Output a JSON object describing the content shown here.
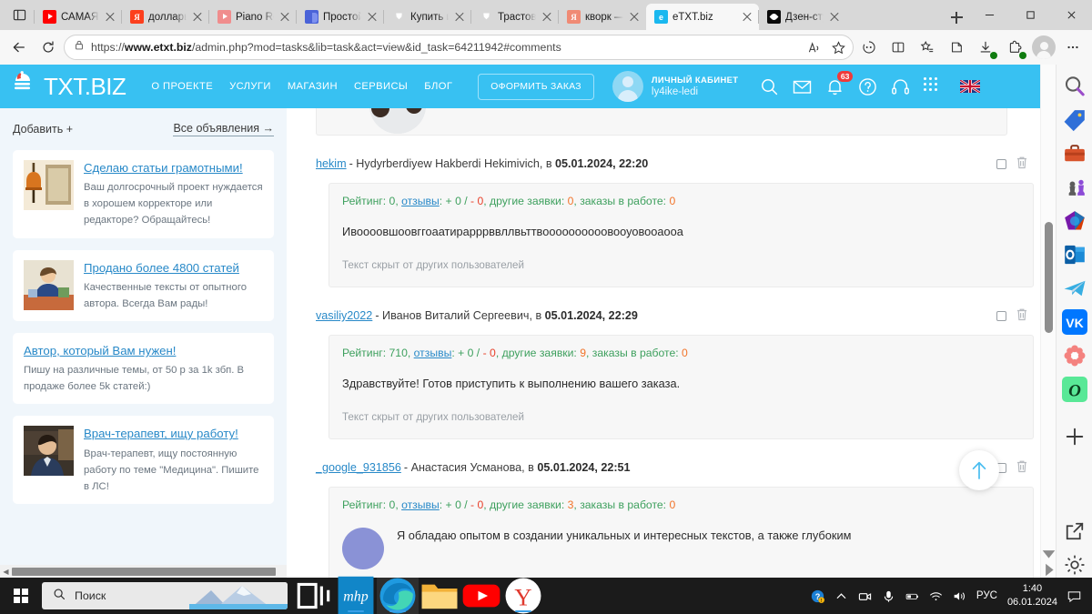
{
  "browser": {
    "tabs": [
      {
        "label": "САМАЯ С",
        "icon": "youtube-icon",
        "favclass": "fav-yt",
        "active": false
      },
      {
        "label": "доллары",
        "icon": "yandex-icon",
        "favclass": "fav-ya",
        "favtext": "Я",
        "active": false
      },
      {
        "label": "Piano Rel",
        "icon": "youtube-icon",
        "favclass": "fav-yt fav-yt-pale",
        "active": false
      },
      {
        "label": "Простой",
        "icon": "blue-doc-icon",
        "favclass": "fav-blue",
        "active": false
      },
      {
        "label": "Купить и",
        "icon": "shield-icon",
        "favclass": "fav-tr",
        "favtext": "⛊",
        "active": false
      },
      {
        "label": "Трастовь",
        "icon": "shield-icon",
        "favclass": "fav-tr",
        "favtext": "⛊",
        "active": false
      },
      {
        "label": "кворк —",
        "icon": "yandex-icon",
        "favclass": "fav-ya fav-ya-pale",
        "favtext": "Я",
        "active": false
      },
      {
        "label": "eTXT.biz",
        "icon": "etxt-icon",
        "favclass": "fav-etxt",
        "favtext": "e",
        "active": true
      },
      {
        "label": "Дзен-сту",
        "icon": "dzen-icon",
        "favclass": "fav-dzen",
        "active": false
      }
    ],
    "new_tab_label": "+",
    "window_controls": {
      "minimize": "—",
      "restore": "❐",
      "close": "✕"
    },
    "url_prefix": "https://",
    "url_domain": "www.etxt.biz",
    "url_path": "/admin.php?mod=tasks&lib=task&act=view&id_task=64211942#comments",
    "toolbar_icons": [
      "back-icon",
      "reload-icon",
      "lock-icon",
      "read-aloud-icon",
      "favorite-star-icon",
      "copilot-icon",
      "split-screen-icon",
      "collections-icon",
      "browser-essentials-icon",
      "downloads-icon",
      "extensions-icon",
      "profile-avatar",
      "settings-more-icon"
    ]
  },
  "site": {
    "logo_text": "TXT.BIZ",
    "nav": [
      {
        "label": "О ПРОЕКТЕ"
      },
      {
        "label": "УСЛУГИ"
      },
      {
        "label": "МАГАЗИН"
      },
      {
        "label": "СЕРВИСЫ"
      },
      {
        "label": "БЛОГ"
      }
    ],
    "order_button": "ОФОРМИТЬ ЗАКАЗ",
    "account": {
      "title": "ЛИЧНЫЙ КАБИНЕТ",
      "username": "ly4ike-ledi"
    },
    "header_icons": [
      "search-icon",
      "mail-icon",
      "bell-icon",
      "help-icon",
      "support-headset-icon",
      "apps-grid-icon",
      "flag-uk-icon"
    ],
    "notification_count": "63",
    "accent_color": "#38c1f2"
  },
  "sidebar": {
    "add_label": "Добавить +",
    "all_label": "Все объявления →",
    "ads": [
      {
        "title": "Сделаю статьи грамотными!",
        "text": "Ваш долгосрочный проект нуждается в хорошем корректоре или редакторе? Обращайтесь!",
        "has_thumb": true,
        "thumb": "bell-and-book-image"
      },
      {
        "title": "Продано более 4800 статей",
        "text": "Качественные тексты от опытного автора. Всегда Вам рады!",
        "has_thumb": true,
        "thumb": "man-at-desk-image"
      },
      {
        "title": "Автор, который Вам нужен!",
        "text": "Пишу на различные темы, от 50 р за 1k збп. В продаже более 5k статей:)",
        "has_thumb": false,
        "thumb": ""
      },
      {
        "title": "Врач-терапевт, ищу работу!",
        "text": "Врач-терапевт, ищу постоянную работу по теме \"Медицина\". Пишите в ЛС!",
        "has_thumb": true,
        "thumb": "man-portrait-image"
      }
    ]
  },
  "comments": [
    {
      "user": "hekim",
      "fullname": "Hydyrberdiyew Hakberdi Hekimivich",
      "sep": " - ",
      "at": ", в ",
      "date": "05.01.2024, 22:20",
      "rating_label": "Рейтинг: ",
      "rating_value": "0",
      "reviews_label": "отзывы",
      "plus_label": ": + ",
      "plus_value": "0",
      "slash": " / ",
      "minus_prefix": "- ",
      "minus_value": "0",
      "other_label": ", другие заявки: ",
      "other_value": "0",
      "inwork_label": ", заказы в работе: ",
      "inwork_value": "0",
      "text": "Ивоооовшоовггоаатирарррввллвьттвоооооооооовооуовооаооа",
      "hidden_note": "Текст скрыт от других пользователей"
    },
    {
      "user": "vasiliy2022",
      "fullname": "Иванов Виталий Сергеевич",
      "sep": " - ",
      "at": ", в ",
      "date": "05.01.2024, 22:29",
      "rating_label": "Рейтинг: ",
      "rating_value": "710",
      "reviews_label": "отзывы",
      "plus_label": ": + ",
      "plus_value": "0",
      "slash": " / ",
      "minus_prefix": "- ",
      "minus_value": "0",
      "other_label": ", другие заявки: ",
      "other_value": "9",
      "inwork_label": ", заказы в работе: ",
      "inwork_value": "0",
      "text": "Здравствуйте! Готов приступить к выполнению вашего заказа.",
      "hidden_note": "Текст скрыт от других пользователей"
    },
    {
      "user": "_google_931856",
      "fullname": "Анастасия Усманова",
      "sep": " - ",
      "at": ", в ",
      "date": "05.01.2024, 22:51",
      "rating_label": "Рейтинг: ",
      "rating_value": "0",
      "reviews_label": "отзывы",
      "plus_label": ": + ",
      "plus_value": "0",
      "slash": " / ",
      "minus_prefix": "- ",
      "minus_value": "0",
      "other_label": ", другие заявки: ",
      "other_value": "3",
      "inwork_label": ", заказы в работе: ",
      "inwork_value": "0",
      "text": "Я обладаю опытом в создании уникальных и интересных текстов, а также глубоким",
      "hidden_note": ""
    }
  ],
  "scroll_top_button": "scroll-to-top-arrow",
  "edge_sidebar": {
    "icons": [
      "search-icon",
      "shopping-tag-icon",
      "tools-icon",
      "games-icon",
      "office-icon",
      "outlook-icon",
      "telegram-icon",
      "vk-icon",
      "odnoklassniki-flower-icon",
      "green-app-icon",
      "add-sidebar-icon",
      "open-in-new-icon",
      "sidebar-settings-icon"
    ]
  },
  "taskbar": {
    "start_label": "start-button",
    "search_placeholder": "Поиск",
    "apps": [
      "task-view-icon",
      "mhp-app-icon",
      "edge-icon",
      "file-explorer-icon",
      "youtube-icon",
      "yandex-icon"
    ],
    "tray": [
      "help-update-icon",
      "show-hidden-icons-chevron",
      "camera-icon",
      "microphone-icon",
      "battery-icon",
      "wifi-icon",
      "volume-icon"
    ],
    "language": "РУС",
    "time": "1:40",
    "date": "06.01.2024",
    "notification_icon": "notification-center-icon"
  }
}
